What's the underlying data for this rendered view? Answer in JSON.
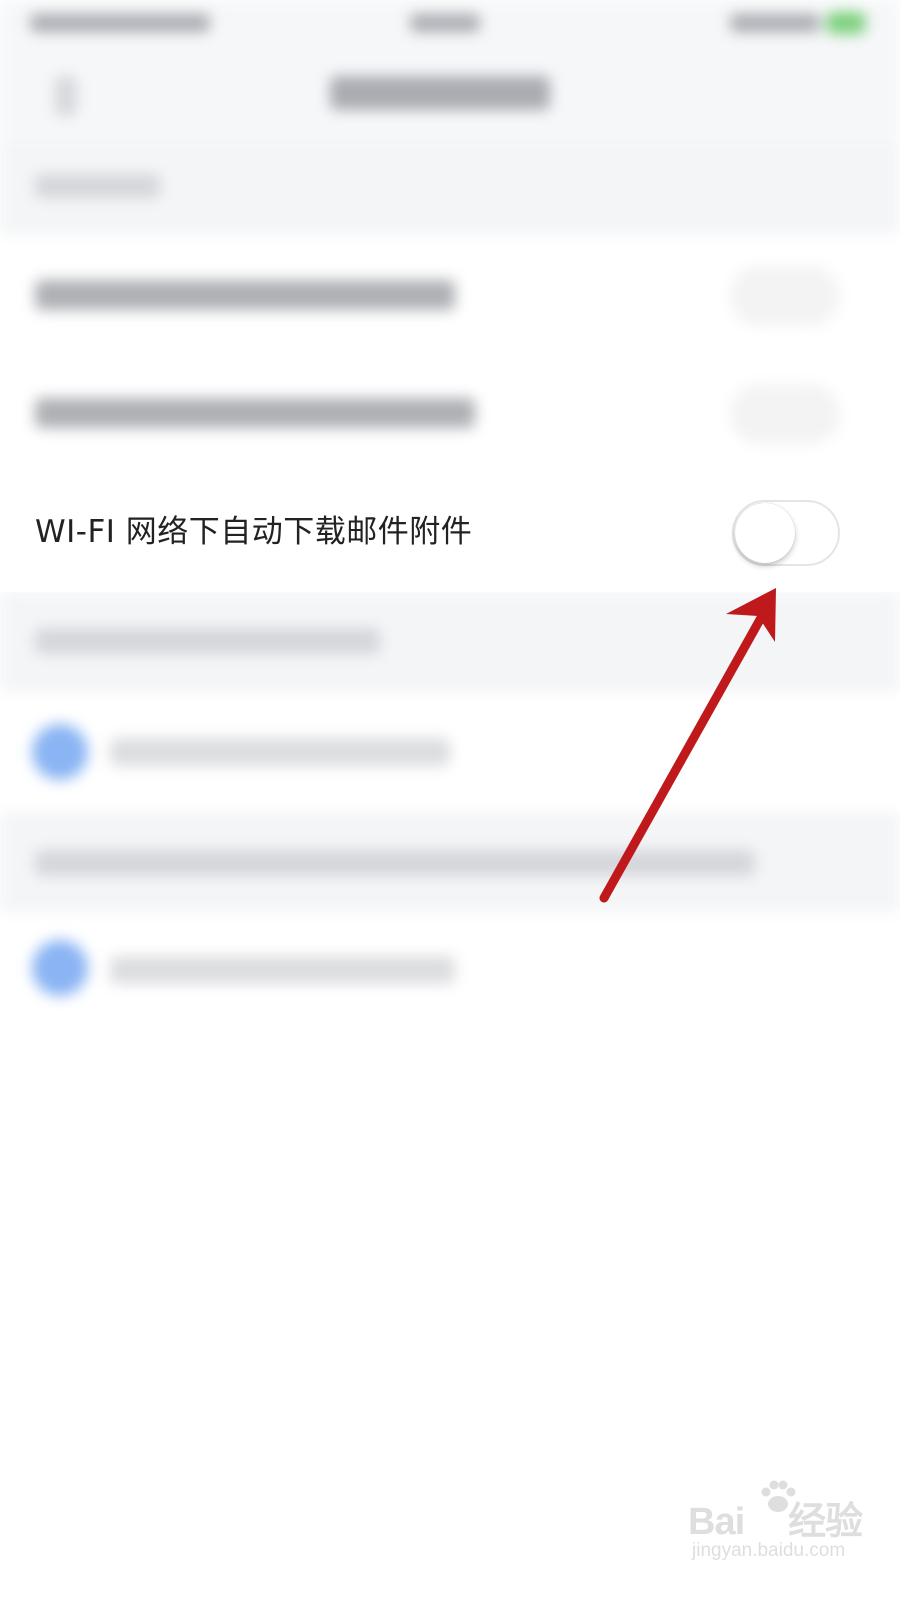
{
  "focused_setting": {
    "label": "WI-FI 网络下自动下载邮件附件",
    "toggle_state": "off"
  },
  "watermark": {
    "brand_left": "Bai",
    "brand_right": "经验",
    "url": "jingyan.baidu.com"
  },
  "colors": {
    "arrow": "#c0191b",
    "toggle_border": "#e4e5e7",
    "blurred_avatar": "#8ab4f4"
  },
  "icons": {
    "toggle": "toggle-switch-off",
    "arrow": "red-annotation-arrow",
    "watermark_logo": "baidu-paw-logo"
  }
}
